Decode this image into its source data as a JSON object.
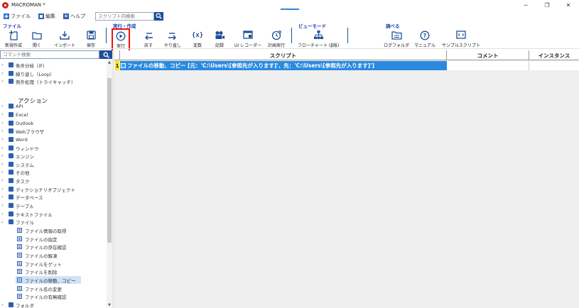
{
  "window": {
    "title": "MACROMAN *",
    "controls": [
      "minimize",
      "maximize",
      "close"
    ]
  },
  "menu": {
    "items": [
      {
        "label": "ファイル",
        "icon": "plus-icon"
      },
      {
        "label": "編集",
        "icon": "edit-icon"
      },
      {
        "label": "ヘルプ",
        "icon": "help-icon"
      }
    ],
    "search_placeholder": "スクリプト内検索"
  },
  "ribbon": {
    "groups": [
      {
        "label": "ファイル",
        "tools": [
          "新規作成",
          "開く",
          "インポート",
          "保存"
        ]
      },
      {
        "label": "実行・作成",
        "tools": [
          "実行",
          "戻す",
          "やり直し",
          "変数",
          "記録",
          "UI レコーダー",
          "計画実行"
        ]
      },
      {
        "label": "ビューモード",
        "tools": [
          "フローチャート (β版)"
        ]
      },
      {
        "label": "調べる",
        "tools": [
          "ログフォルダ",
          "マニュアル",
          "サンプルスクリプト"
        ]
      }
    ],
    "active_tool": "実行"
  },
  "command_search": {
    "placeholder": "コマンド検索"
  },
  "tree": {
    "top_items": [
      "条件分岐（IF）",
      "繰り返し（Loop）",
      "例外処理（トライキャッチ）"
    ],
    "section_title": "アクション",
    "categories": [
      "API",
      "Excel",
      "Outlook",
      "Webブラウザ",
      "Word",
      "ウィンドウ",
      "エンジン",
      "システム",
      "その他",
      "タスク",
      "ディクショナリオブジェクト",
      "データベース",
      "テーブル",
      "テキストファイル",
      "ファイル"
    ],
    "file_children": [
      "ファイル情報の取得",
      "ファイルの指定",
      "ファイルの存在確認",
      "ファイルの解凍",
      "ファイルをゲット",
      "ファイルを削除",
      "ファイルの移動、コピー",
      "ファイル名の変更",
      "ファイルの有無確認"
    ],
    "selected": "ファイルの移動、コピー",
    "last_item": "フォルダ"
  },
  "grid": {
    "headers": [
      "スクリプト",
      "コメント",
      "インスタンス"
    ],
    "rows": [
      {
        "number": "1",
        "script": "ファイルの移動、コピー [元：'C:\\Users\\[参照先が入ります]'、先：'C:\\Users\\[参照先が入ります]']",
        "comment": "",
        "instance": ""
      }
    ]
  },
  "colors": {
    "accent": "#1f4f99",
    "selected_row": "#2a8ae0",
    "highlight": "#ffe600",
    "active_border": "#ee1111"
  }
}
